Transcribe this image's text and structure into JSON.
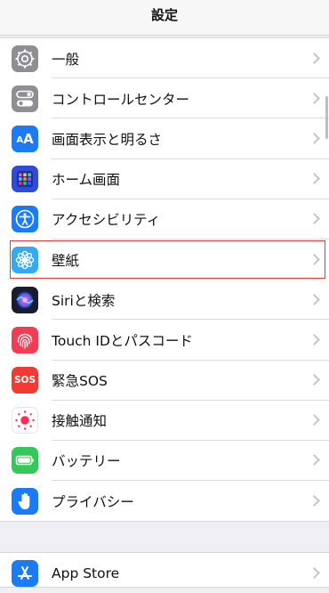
{
  "navbar": {
    "title": "設定"
  },
  "settings": {
    "items": [
      {
        "label": "一般",
        "icon": "gear-icon",
        "color": "#8e8e93"
      },
      {
        "label": "コントロールセンター",
        "icon": "toggle-switches-icon",
        "color": "#8e8e93"
      },
      {
        "label": "画面表示と明るさ",
        "icon": "text-size-icon",
        "color": "#1a7bf5"
      },
      {
        "label": "ホーム画面",
        "icon": "app-grid-icon",
        "color": "#2f4bd7"
      },
      {
        "label": "アクセシビリティ",
        "icon": "accessibility-person-icon",
        "color": "#1a7bf5"
      },
      {
        "label": "壁紙",
        "icon": "flower-icon",
        "color": "#35a9f2",
        "highlighted": true
      },
      {
        "label": "Siriと検索",
        "icon": "siri-orb-icon",
        "color": "#1b1b2f"
      },
      {
        "label": "Touch IDとパスコード",
        "icon": "fingerprint-icon",
        "color": "#f13d53"
      },
      {
        "label": "緊急SOS",
        "icon": "sos-icon",
        "color": "#f03a32",
        "icon_text": "SOS"
      },
      {
        "label": "接触通知",
        "icon": "exposure-dots-icon",
        "color": "#ffffff"
      },
      {
        "label": "バッテリー",
        "icon": "battery-icon",
        "color": "#34c759"
      },
      {
        "label": "プライバシー",
        "icon": "raised-hand-icon",
        "color": "#1a7bf5"
      }
    ]
  },
  "store_group": {
    "items": [
      {
        "label": "App Store",
        "icon": "app-store-icon",
        "color": "#1a7bf5"
      }
    ]
  }
}
